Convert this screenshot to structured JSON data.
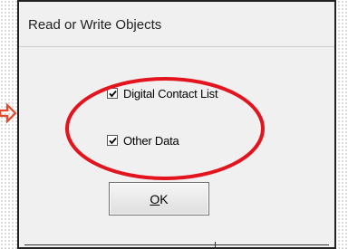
{
  "annotation": {
    "arrow_icon": "arrow-right-icon",
    "arrow_color": "#e8462a",
    "oval_color": "#e3141d"
  },
  "dialog": {
    "title": "Read or Write Objects",
    "checkboxes": [
      {
        "label": "Digital Contact List",
        "checked": true
      },
      {
        "label": "Other Data",
        "checked": true
      }
    ],
    "ok_button": {
      "mnemonic": "O",
      "rest": "K"
    }
  }
}
